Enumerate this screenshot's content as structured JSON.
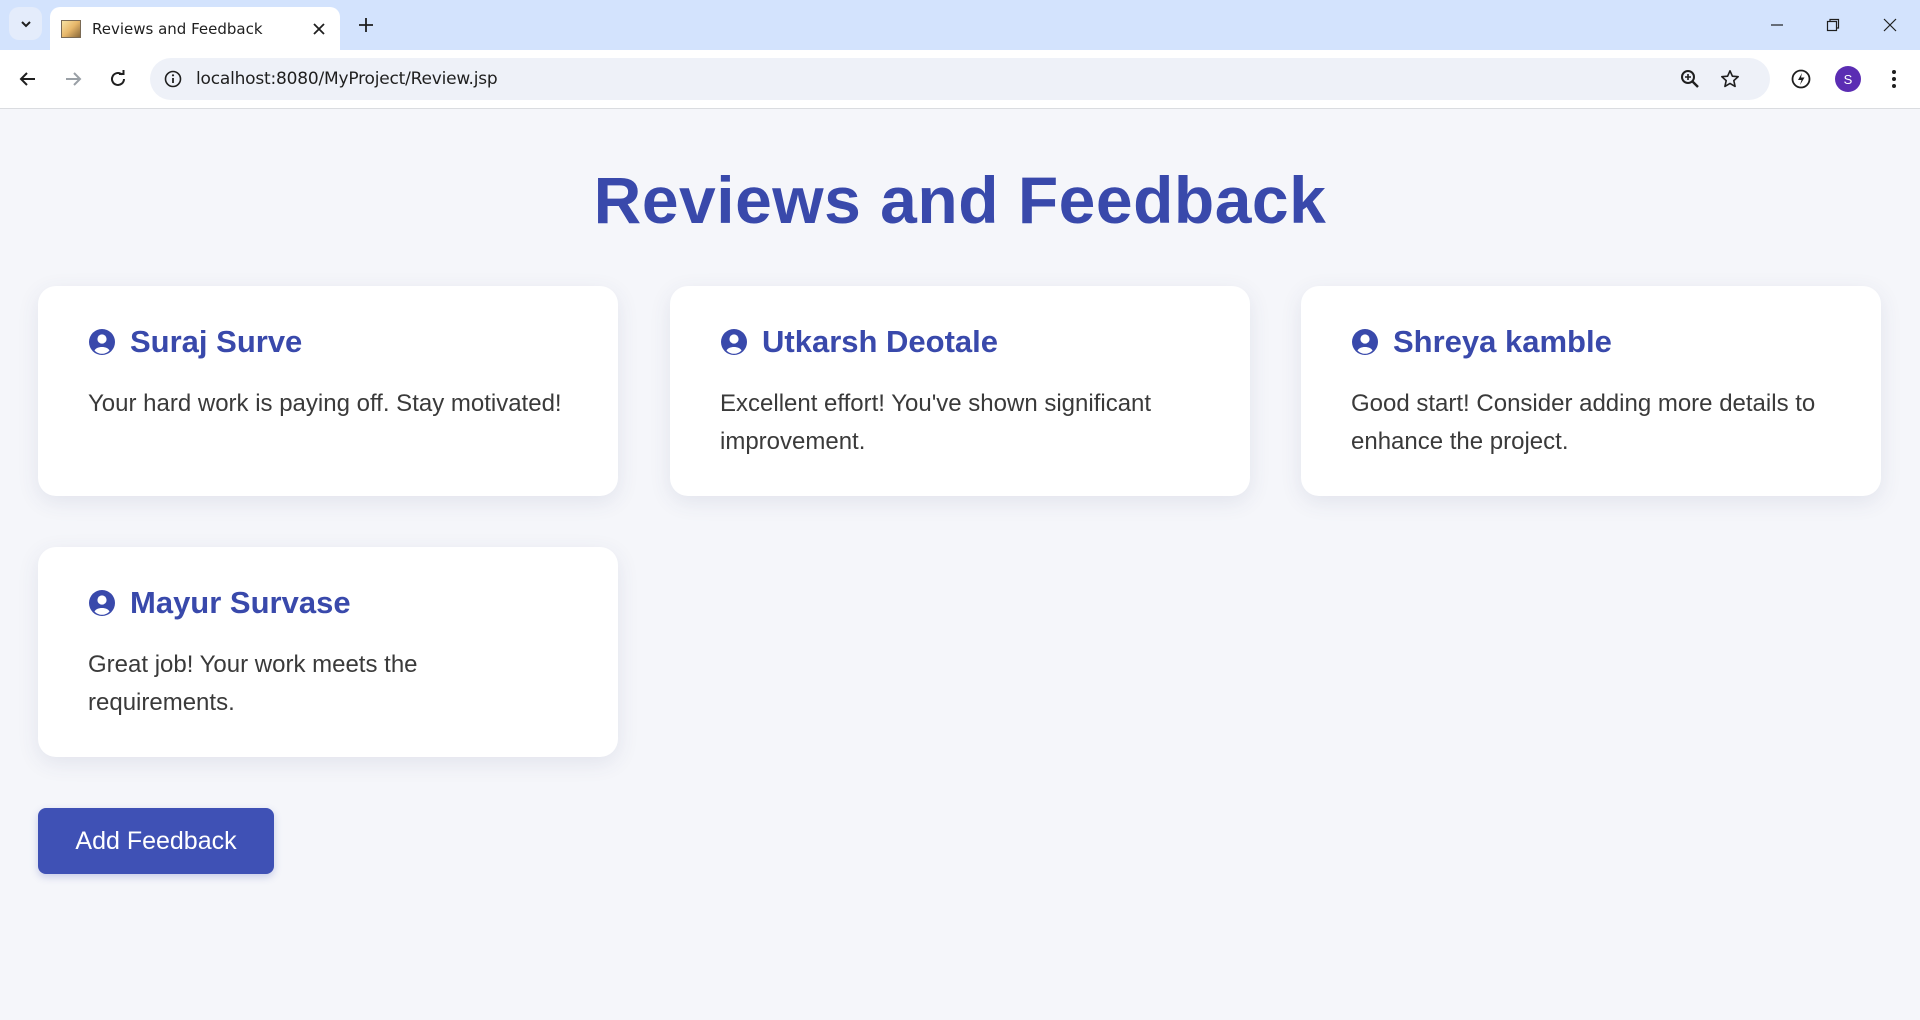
{
  "browser": {
    "tab_title": "Reviews and Feedback",
    "url": "localhost:8080/MyProject/Review.jsp",
    "profile_initial": "S"
  },
  "page": {
    "title": "Reviews and Feedback",
    "add_button_label": "Add Feedback"
  },
  "reviews": [
    {
      "name": "Suraj Surve",
      "text": "Your hard work is paying off. Stay motivated!"
    },
    {
      "name": "Utkarsh Deotale",
      "text": "Excellent effort! You've shown significant improvement."
    },
    {
      "name": "Shreya kamble",
      "text": "Good start! Consider adding more details to enhance the project."
    },
    {
      "name": "Mayur Survase",
      "text": "Great job! Your work meets the requirements."
    }
  ],
  "colors": {
    "accent": "#3949ab",
    "button": "#3f51b5",
    "background": "#f5f6fa",
    "chrome": "#d3e3fd"
  },
  "icons": {
    "user": "user-circle-icon",
    "tab_search": "chevron-down-icon",
    "close": "close-icon",
    "new_tab": "plus-icon",
    "back": "back-arrow-icon",
    "forward": "forward-arrow-icon",
    "reload": "reload-icon",
    "info": "info-icon",
    "zoom": "zoom-icon",
    "bookmark": "star-icon",
    "extensions": "extension-icon",
    "menu": "kebab-menu-icon"
  }
}
